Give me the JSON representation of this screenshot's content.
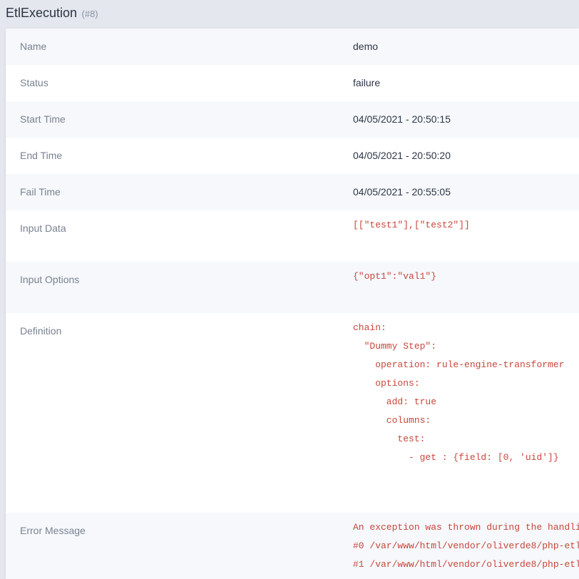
{
  "header": {
    "title": "EtlExecution",
    "id_label": "(#8)"
  },
  "fields": {
    "name": {
      "label": "Name",
      "value": "demo"
    },
    "status": {
      "label": "Status",
      "value": "failure"
    },
    "start_time": {
      "label": "Start Time",
      "value": "04/05/2021 - 20:50:15"
    },
    "end_time": {
      "label": "End Time",
      "value": "04/05/2021 - 20:50:20"
    },
    "fail_time": {
      "label": "Fail Time",
      "value": "04/05/2021 - 20:55:05"
    },
    "input_data": {
      "label": "Input Data",
      "value": "[[\"test1\"],[\"test2\"]]"
    },
    "input_options": {
      "label": "Input Options",
      "value": "{\"opt1\":\"val1\"}"
    },
    "definition": {
      "label": "Definition",
      "lines": [
        "chain:",
        "  \"Dummy Step\":",
        "    operation: rule-engine-transformer",
        "    options:",
        "      add: true",
        "      columns:",
        "        test:",
        "          - get : {field: [0, 'uid']}"
      ]
    },
    "error_message": {
      "label": "Error Message",
      "lines": [
        "An exception was thrown during the handli",
        "#0 /var/www/html/vendor/oliverde8/php-etl",
        "#1 /var/www/html/vendor/oliverde8/php-etl"
      ]
    }
  }
}
